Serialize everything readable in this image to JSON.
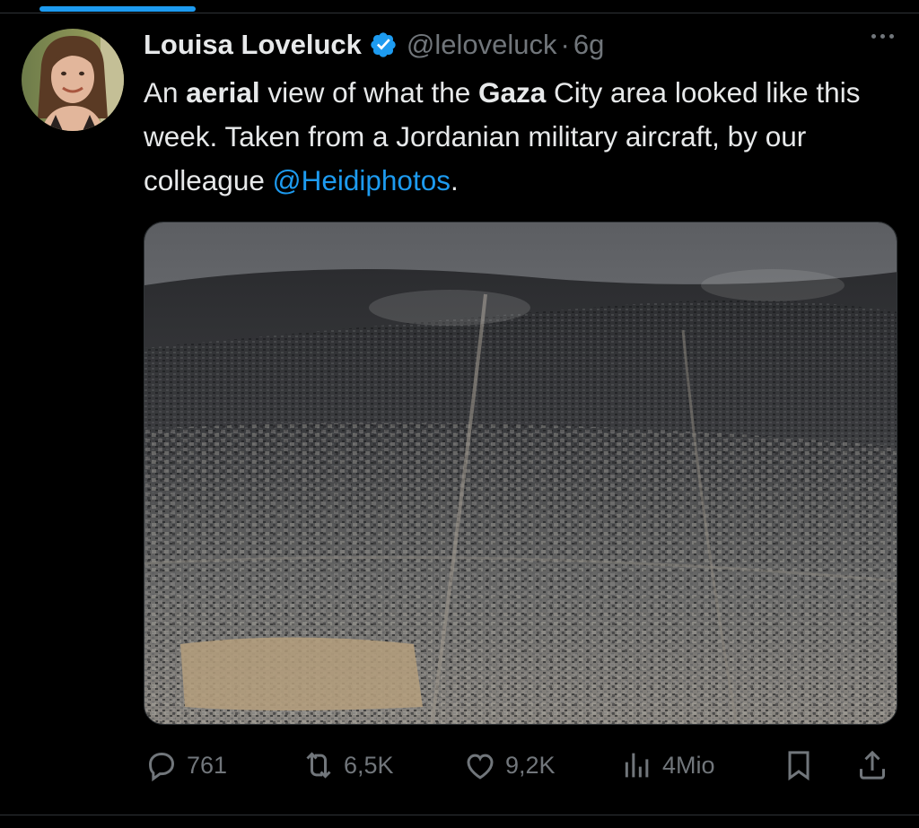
{
  "tweet": {
    "author": {
      "display_name": "Louisa Loveluck",
      "handle": "@leloveluck",
      "verified": true,
      "avatar_icon": "avatar-photo"
    },
    "separator": "·",
    "timestamp": "6g",
    "text_parts": [
      {
        "text": "An ",
        "style": "normal"
      },
      {
        "text": "aerial",
        "style": "bold"
      },
      {
        "text": " view of what the ",
        "style": "normal"
      },
      {
        "text": "Gaza",
        "style": "bold"
      },
      {
        "text": " City area looked like this week. Taken from a Jordanian military aircraft, by our colleague ",
        "style": "normal"
      },
      {
        "text": "@Heidiphotos",
        "style": "mention"
      },
      {
        "text": ".",
        "style": "normal"
      }
    ],
    "media": {
      "type": "photo",
      "icon": "aerial-city-photo"
    },
    "actions": {
      "replies": "761",
      "reposts": "6,5K",
      "likes": "9,2K",
      "views": "4Mio"
    }
  },
  "colors": {
    "background": "#000000",
    "text": "#e7e9ea",
    "muted": "#71767b",
    "accent": "#1d9bf0",
    "divider": "#2f3336"
  },
  "icons": {
    "more": "more-dots-icon",
    "verified": "verified-badge-icon",
    "reply": "reply-bubble-icon",
    "repost": "repost-arrows-icon",
    "like": "heart-icon",
    "views": "views-chart-icon",
    "bookmark": "bookmark-icon",
    "share": "share-upload-icon"
  }
}
